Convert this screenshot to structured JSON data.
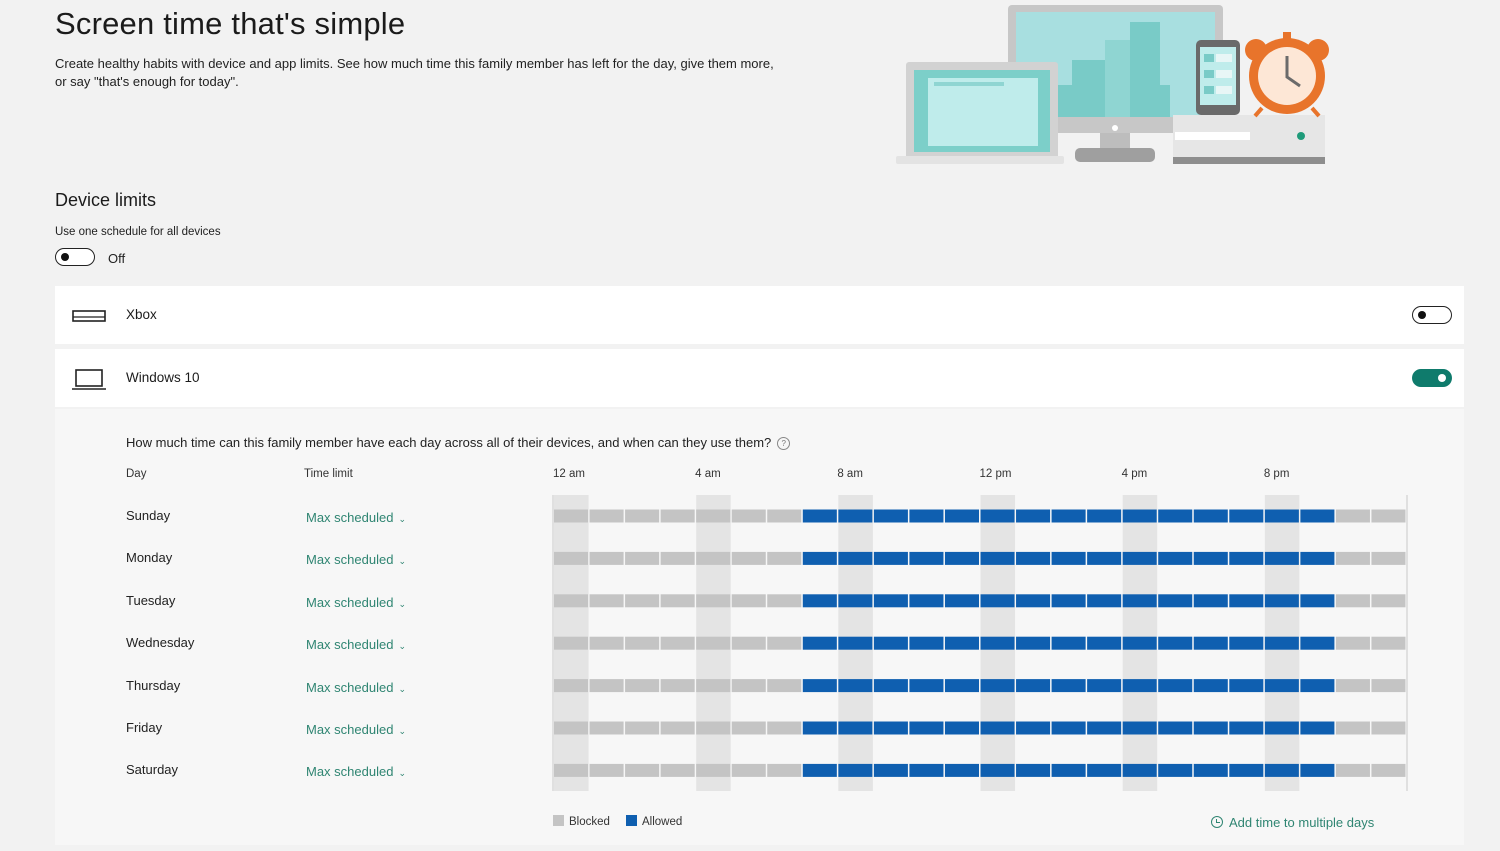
{
  "hero": {
    "title": "Screen time that's simple",
    "description": "Create healthy habits with device and app limits. See how much time this family member has left for the day, give them more, or say \"that's enough for today\"."
  },
  "device_limits": {
    "title": "Device limits",
    "schedule_label": "Use one schedule for all devices",
    "schedule_toggle_state": "Off",
    "devices": [
      {
        "name": "Xbox",
        "icon": "xbox-console-icon",
        "enabled": false
      },
      {
        "name": "Windows 10",
        "icon": "laptop-icon",
        "enabled": true
      }
    ]
  },
  "schedule": {
    "question": "How much time can this family member have each day across all of their devices, and when can they use them?",
    "help_icon": "?",
    "headers": {
      "day": "Day",
      "time_limit": "Time limit"
    },
    "time_labels": [
      "12 am",
      "4 am",
      "8 am",
      "12 pm",
      "4 pm",
      "8 pm"
    ],
    "days": [
      {
        "day": "Sunday",
        "limit": "Max scheduled"
      },
      {
        "day": "Monday",
        "limit": "Max scheduled"
      },
      {
        "day": "Tuesday",
        "limit": "Max scheduled"
      },
      {
        "day": "Wednesday",
        "limit": "Max scheduled"
      },
      {
        "day": "Thursday",
        "limit": "Max scheduled"
      },
      {
        "day": "Friday",
        "limit": "Max scheduled"
      },
      {
        "day": "Saturday",
        "limit": "Max scheduled"
      }
    ],
    "allowed_start_hour": 7,
    "allowed_end_hour": 22,
    "hours_total": 24,
    "legend": {
      "blocked": "Blocked",
      "allowed": "Allowed"
    },
    "add_time_label": "Add time to multiple days"
  },
  "colors": {
    "accent": "#0f7b6c",
    "link": "#2f8572",
    "allowed": "#0f5fb0",
    "blocked": "#c4c4c4"
  }
}
